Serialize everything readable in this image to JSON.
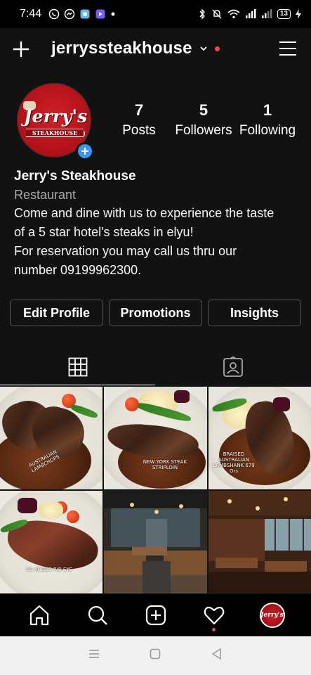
{
  "status_bar": {
    "time": "7:44",
    "battery": "13"
  },
  "header": {
    "username": "jerryssteakhouse"
  },
  "profile": {
    "avatar_text": "Jerry's",
    "avatar_subtext": "STEAKHOUSE",
    "stats": [
      {
        "value": "7",
        "label": "Posts"
      },
      {
        "value": "5",
        "label": "Followers"
      },
      {
        "value": "1",
        "label": "Following"
      }
    ]
  },
  "bio": {
    "name": "Jerry's Steakhouse",
    "category": "Restaurant",
    "lines": [
      "Come and dine with us to experience the taste",
      "of a 5 star hotel's steaks in elyu!",
      "For reservation you may call us thru our",
      "number 09199962300."
    ]
  },
  "buttons": {
    "edit_profile": "Edit Profile",
    "promotions": "Promotions",
    "insights": "Insights"
  },
  "posts": [
    {
      "caption": "AUSTRALIAN LAMBCHOPS"
    },
    {
      "caption": "NEW YORK STEAK STRIPLOIN"
    },
    {
      "caption": "BRAISED AUSTRALIAN LAMBSHANK 679 Grs"
    },
    {
      "caption": "US ANGUS RIB EYE"
    },
    {
      "caption": ""
    },
    {
      "caption": ""
    }
  ],
  "colors": {
    "background": "#121212",
    "accent_blue": "#3897f0",
    "notification_red": "#ed4956"
  }
}
